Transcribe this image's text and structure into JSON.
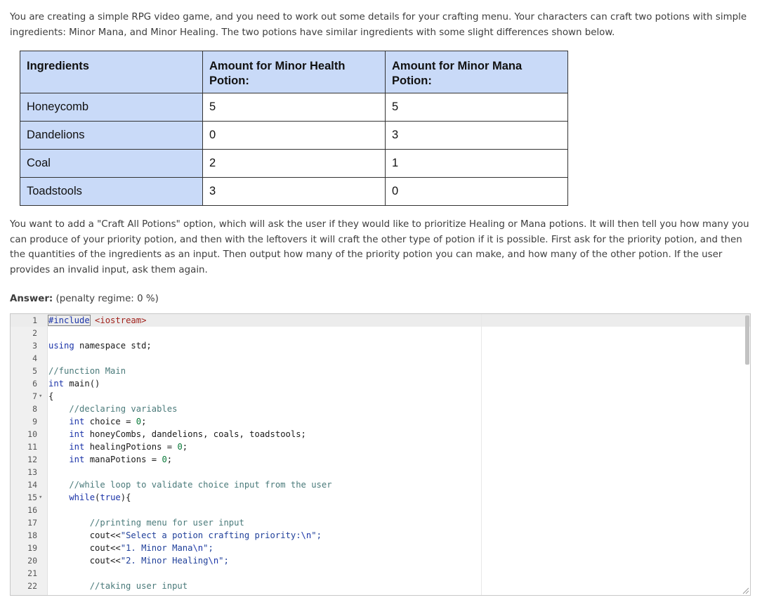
{
  "intro": "You are creating a simple RPG video game, and you need to work out some details for your crafting menu. Your characters can craft two potions with simple ingredients: Minor Mana, and Minor Healing. The two potions have similar ingredients with some slight differences shown below.",
  "table": {
    "headers": [
      "Ingredients",
      "Amount for Minor Health Potion:",
      "Amount for Minor Mana Potion:"
    ],
    "rows": [
      {
        "name": "Honeycomb",
        "health": "5",
        "mana": "5"
      },
      {
        "name": "Dandelions",
        "health": "0",
        "mana": "3"
      },
      {
        "name": "Coal",
        "health": "2",
        "mana": "1"
      },
      {
        "name": "Toadstools",
        "health": "3",
        "mana": "0"
      }
    ]
  },
  "task": "You want to add a \"Craft All Potions\" option, which will ask the user if they would like to prioritize Healing or Mana potions. It will then tell you how many you can produce of your priority potion, and then with the leftovers it will craft the other type of potion if it is possible. First ask for the priority potion, and then the quantities of the ingredients as an input. Then output how many of the priority potion you can make, and how many of the other potion. If the user provides an invalid input, ask them again.",
  "answer_label": "Answer:",
  "penalty": "(penalty regime: 0 %)",
  "code_lines": [
    "1",
    "2",
    "3",
    "4",
    "5",
    "6",
    "7",
    "8",
    "9",
    "10",
    "11",
    "12",
    "13",
    "14",
    "15",
    "16",
    "17",
    "18",
    "19",
    "20",
    "21",
    "22"
  ],
  "code": {
    "l1a": "#include",
    "l1b": " <iostream>",
    "l3a": "using",
    "l3b": " namespace std;",
    "l5": "//function Main",
    "l6a": "int",
    "l6b": " main()",
    "l7": "{",
    "l8": "    //declaring variables",
    "l9a": "    int",
    "l9b": " choice = ",
    "l9c": "0",
    "l9d": ";",
    "l10a": "    int",
    "l10b": " honeyCombs, dandelions, coals, toadstools;",
    "l11a": "    int",
    "l11b": " healingPotions = ",
    "l11c": "0",
    "l11d": ";",
    "l12a": "    int",
    "l12b": " manaPotions = ",
    "l12c": "0",
    "l12d": ";",
    "l14": "    //while loop to validate choice input from the user",
    "l15a": "    while",
    "l15b": "(",
    "l15c": "true",
    "l15d": "){",
    "l17": "        //printing menu for user input",
    "l18a": "        cout<<",
    "l18b": "\"Select a potion crafting priority:",
    "l18c": "\\n",
    "l18d": "\";",
    "l19a": "        cout<<",
    "l19b": "\"1. Minor Mana",
    "l19c": "\\n",
    "l19d": "\";",
    "l20a": "        cout<<",
    "l20b": "\"2. Minor Healing",
    "l20c": "\\n",
    "l20d": "\";",
    "l22": "        //taking user input"
  }
}
